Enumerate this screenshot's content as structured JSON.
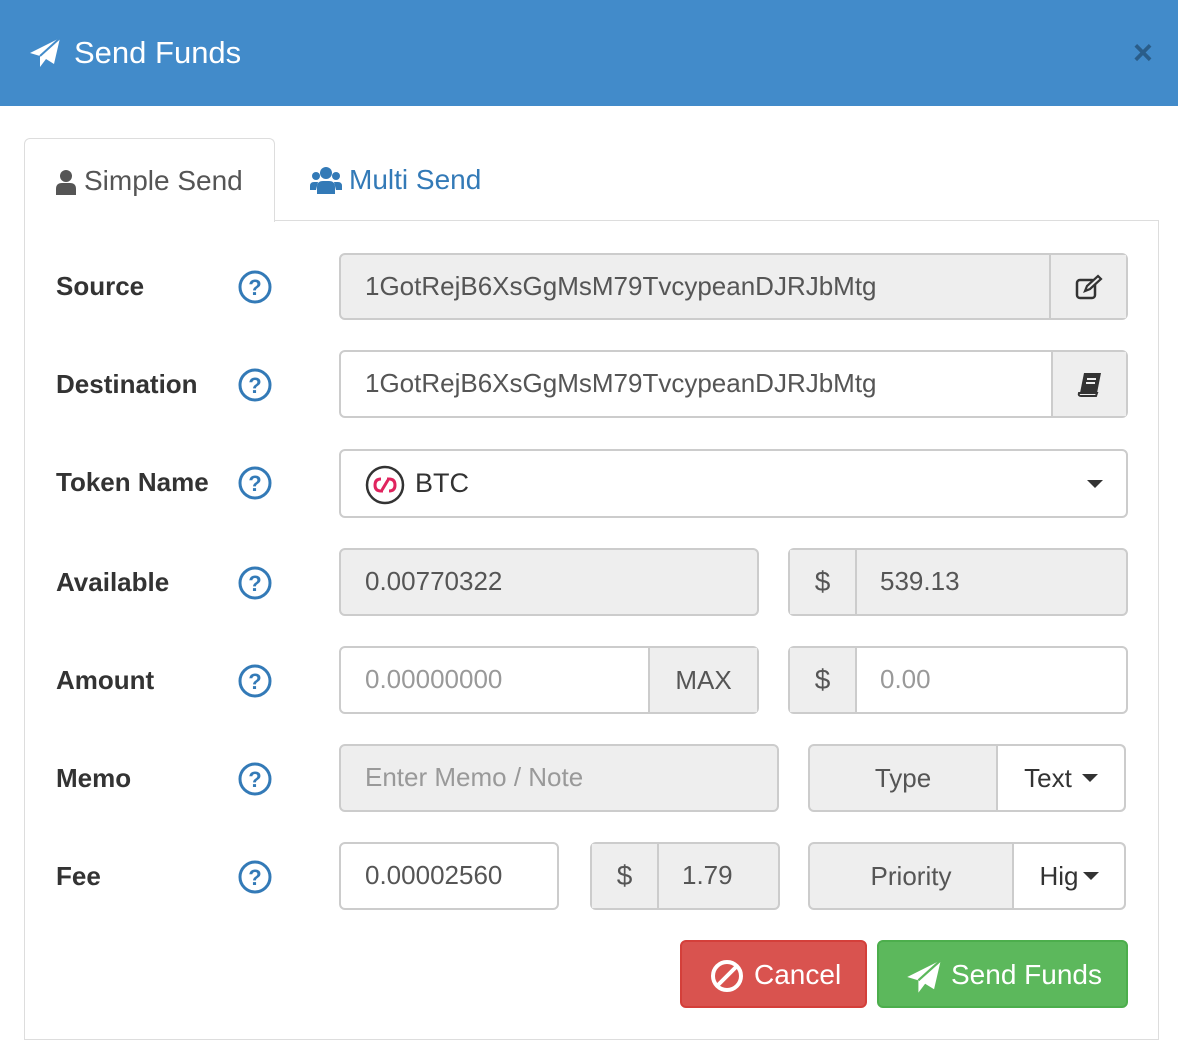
{
  "dialog": {
    "title": "Send Funds",
    "close_label": "×"
  },
  "tabs": [
    {
      "label": "Simple Send",
      "active": true
    },
    {
      "label": "Multi Send",
      "active": false
    }
  ],
  "form": {
    "source": {
      "label": "Source",
      "value": "1GotRejB6XsGgMsM79TvcypeanDJRJbMtg"
    },
    "destination": {
      "label": "Destination",
      "value": "1GotRejB6XsGgMsM79TvcypeanDJRJbMtg"
    },
    "token": {
      "label": "Token Name",
      "value": "BTC"
    },
    "available": {
      "label": "Available",
      "value": "0.00770322",
      "usd_symbol": "$",
      "usd_value": "539.13"
    },
    "amount": {
      "label": "Amount",
      "placeholder": "0.00000000",
      "max_label": "MAX",
      "usd_symbol": "$",
      "usd_placeholder": "0.00"
    },
    "memo": {
      "label": "Memo",
      "placeholder": "Enter Memo / Note",
      "type_label": "Type",
      "type_value": "Text"
    },
    "fee": {
      "label": "Fee",
      "value": "0.00002560",
      "usd_symbol": "$",
      "usd_value": "1.79",
      "priority_label": "Priority",
      "priority_value": "Hig"
    }
  },
  "buttons": {
    "cancel": "Cancel",
    "send": "Send Funds"
  },
  "colors": {
    "header_bg": "#428bca",
    "cancel_bg": "#d9534f",
    "send_bg": "#5cb85c",
    "link": "#337ab7"
  }
}
